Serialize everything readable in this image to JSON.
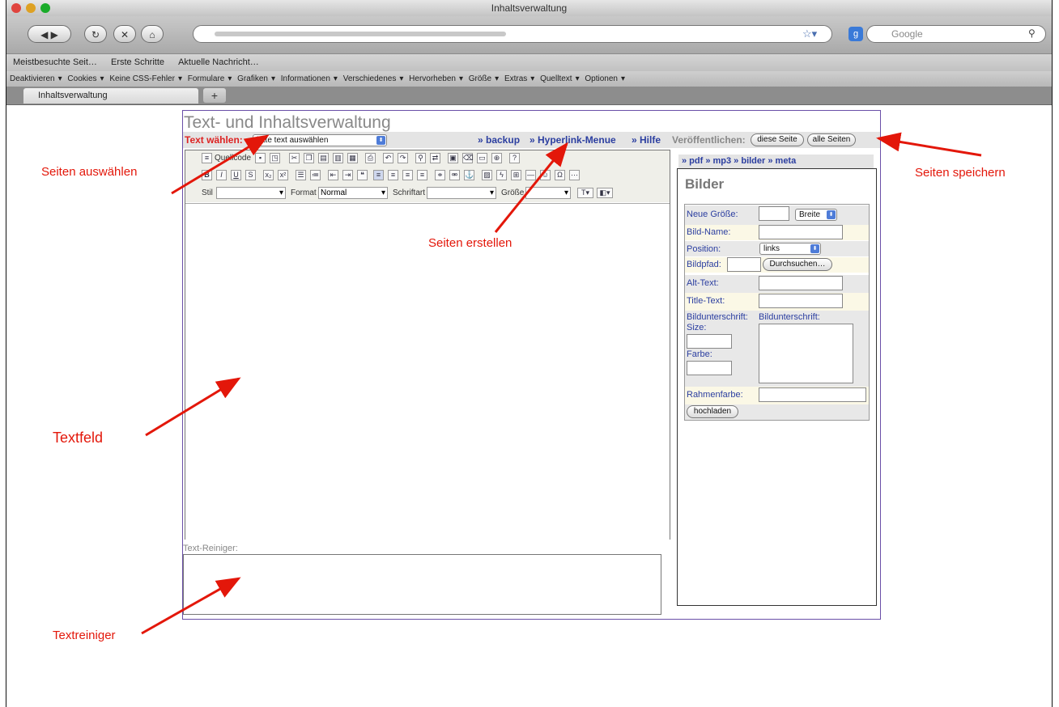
{
  "window": {
    "title": "Inhaltsverwaltung"
  },
  "search": {
    "placeholder": "Google"
  },
  "bookmarks": [
    "Meistbesuchte Seit…",
    "Erste Schritte",
    "Aktuelle Nachricht…"
  ],
  "webdev_toolbar": [
    "Deaktivieren",
    "Cookies",
    "Keine CSS-Fehler",
    "Formulare",
    "Grafiken",
    "Informationen",
    "Verschiedenes",
    "Hervorheben",
    "Größe",
    "Extras",
    "Quelltext",
    "Optionen"
  ],
  "tab": {
    "label": "Inhaltsverwaltung"
  },
  "page": {
    "title": "Text- und Inhaltsverwaltung",
    "text_label": "Text wählen:",
    "text_select": "bitte text auswählen",
    "links": {
      "backup": "» backup",
      "hyperlink": "» Hyperlink-Menue",
      "hilfe": "» Hilfe"
    },
    "publish_label": "Veröffentlichen:",
    "publish_this": "diese Seite",
    "publish_all": "alle Seiten"
  },
  "editor": {
    "source": "Quellcode",
    "stil": "Stil",
    "format_label": "Format",
    "format_value": "Normal",
    "schriftart": "Schriftart",
    "groesse": "Größe",
    "bold": "B",
    "italic": "I",
    "underline": "U"
  },
  "reiniger": {
    "label": "Text-Reiniger:"
  },
  "right": {
    "tabs": "» pdf » mp3 » bilder » meta",
    "heading": "Bilder",
    "neue_groesse": "Neue Größe:",
    "breite": "Breite",
    "bild_name": "Bild-Name:",
    "position": "Position:",
    "position_value": "links",
    "bildpfad": "Bildpfad:",
    "durchsuchen": "Durchsuchen…",
    "alt_text": "Alt-Text:",
    "title_text": "Title-Text:",
    "bildunterschrift": "Bildunterschrift:",
    "bildunterschrift2": "Bildunterschrift:",
    "size": "Size:",
    "farbe": "Farbe:",
    "rahmenfarbe": "Rahmenfarbe:",
    "hochladen": "hochladen"
  },
  "annotations": {
    "seiten_auswaehlen": "Seiten auswählen",
    "seiten_erstellen": "Seiten erstellen",
    "seiten_speichern": "Seiten speichern",
    "textfeld": "Textfeld",
    "textreiniger": "Textreiniger"
  }
}
